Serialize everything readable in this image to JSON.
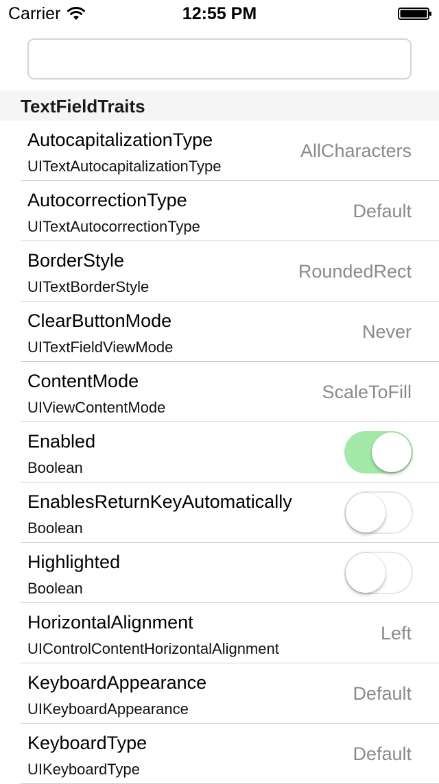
{
  "status_bar": {
    "carrier": "Carrier",
    "time": "12:55 PM",
    "icons": [
      "wifi-icon",
      "battery-icon"
    ]
  },
  "search": {
    "value": "",
    "placeholder": ""
  },
  "section": {
    "title": "TextFieldTraits"
  },
  "colors": {
    "switch_on": "#a3eaa8",
    "value_text": "#8a8a8a",
    "section_bg": "#f5f5f5"
  },
  "rows": [
    {
      "title": "AutocapitalizationType",
      "subtitle": "UITextAutocapitalizationType",
      "value": "AllCharacters"
    },
    {
      "title": "AutocorrectionType",
      "subtitle": "UITextAutocorrectionType",
      "value": "Default"
    },
    {
      "title": "BorderStyle",
      "subtitle": "UITextBorderStyle",
      "value": "RoundedRect"
    },
    {
      "title": "ClearButtonMode",
      "subtitle": "UITextFieldViewMode",
      "value": "Never"
    },
    {
      "title": "ContentMode",
      "subtitle": "UIViewContentMode",
      "value": "ScaleToFill"
    },
    {
      "title": "Enabled",
      "subtitle": "Boolean",
      "toggle": true
    },
    {
      "title": "EnablesReturnKeyAutomatically",
      "subtitle": "Boolean",
      "toggle": false
    },
    {
      "title": "Highlighted",
      "subtitle": "Boolean",
      "toggle": false
    },
    {
      "title": "HorizontalAlignment",
      "subtitle": "UIControlContentHorizontalAlignment",
      "value": "Left"
    },
    {
      "title": "KeyboardAppearance",
      "subtitle": "UIKeyboardAppearance",
      "value": "Default"
    },
    {
      "title": "KeyboardType",
      "subtitle": "UIKeyboardType",
      "value": "Default"
    }
  ]
}
